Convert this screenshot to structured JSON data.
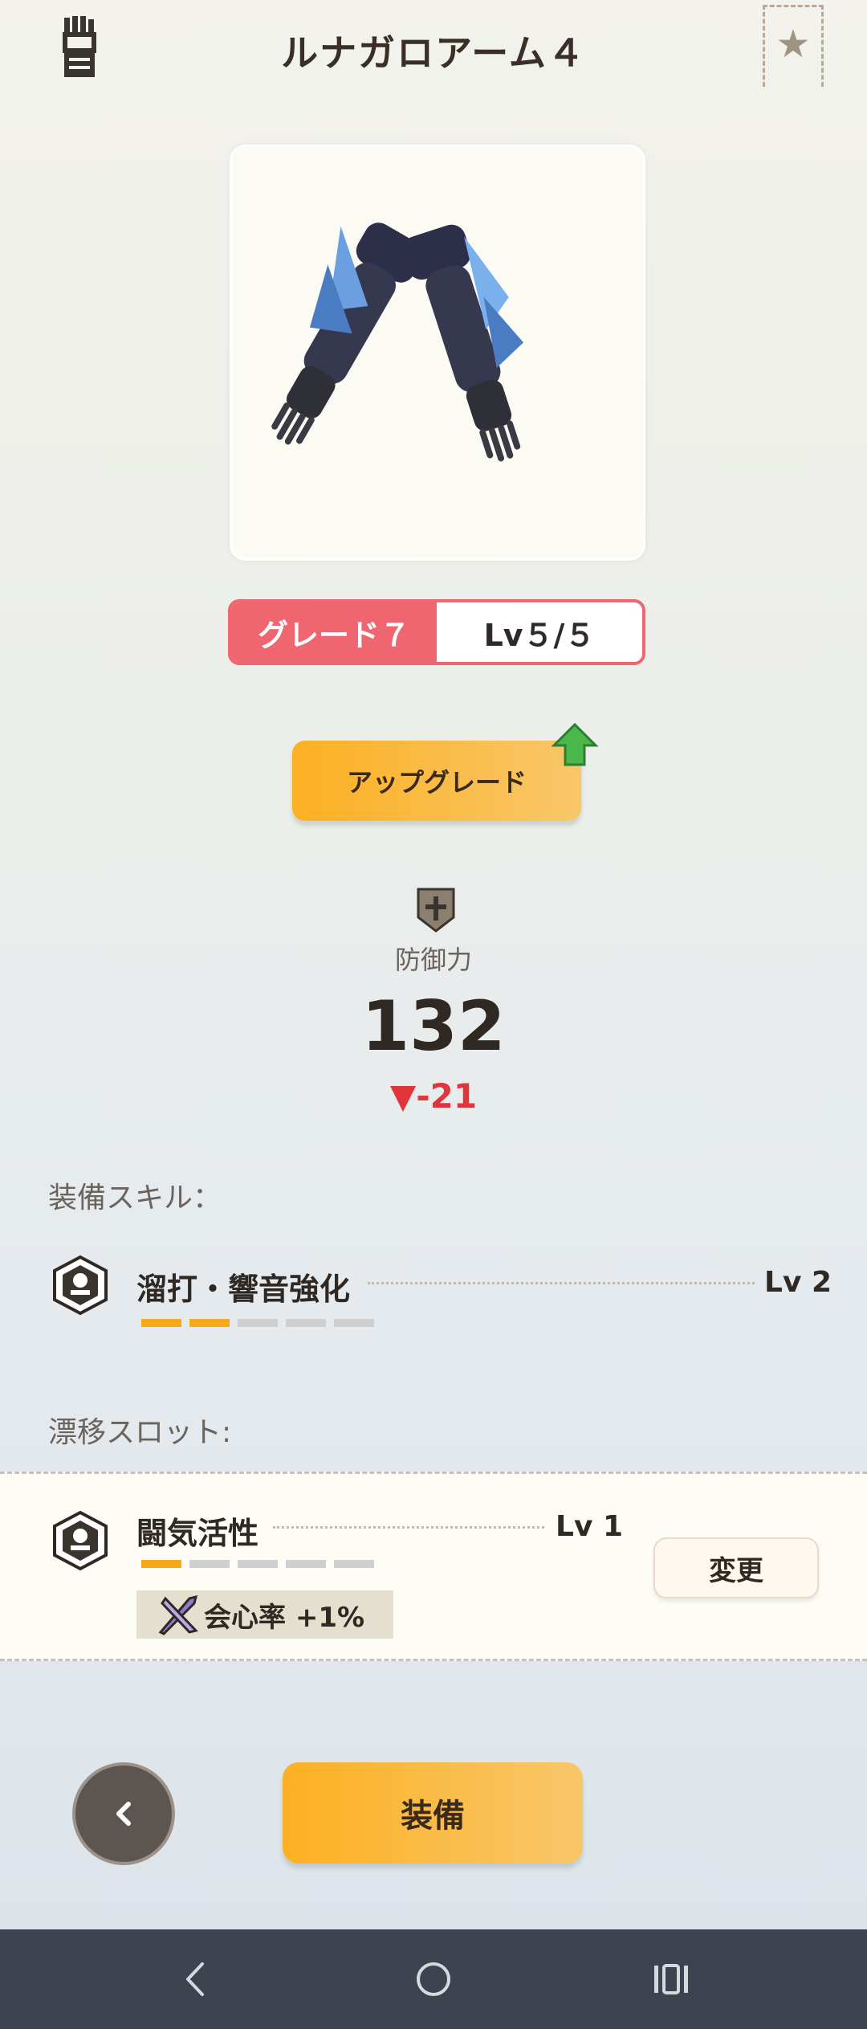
{
  "header": {
    "title": "ルナガロアーム４",
    "equip_icon": "gauntlet-icon",
    "favorite_icon": "star-icon"
  },
  "item": {
    "image": "lunagaron-arm-image"
  },
  "grade": {
    "grade_label": "グレード７",
    "level_label": "Lv５/５"
  },
  "upgrade": {
    "label": "アップグレード",
    "indicator_icon": "green-up-arrow-icon"
  },
  "defense": {
    "label": "防御力",
    "value": "132",
    "diff": "▼-21",
    "diff_color": "#e0353b"
  },
  "equip_skills": {
    "section_label": "装備スキル：",
    "items": [
      {
        "name": "溜打・響音強化",
        "level": "Lv 2",
        "level_value": 2,
        "max_level": 5
      }
    ]
  },
  "drift_slot": {
    "section_label": "漂移スロット:",
    "items": [
      {
        "name": "闘気活性",
        "level": "Lv 1",
        "level_value": 1,
        "max_level": 5,
        "effect": "会心率 +1%"
      }
    ],
    "change_label": "変更"
  },
  "footer": {
    "back_icon": "chevron-left-icon",
    "equip_label": "装備"
  },
  "android_nav": {
    "back": "nav-back-icon",
    "home": "nav-home-icon",
    "recents": "nav-recents-icon"
  },
  "colors": {
    "accent_orange": "#fdb022",
    "grade_red": "#f06670"
  }
}
